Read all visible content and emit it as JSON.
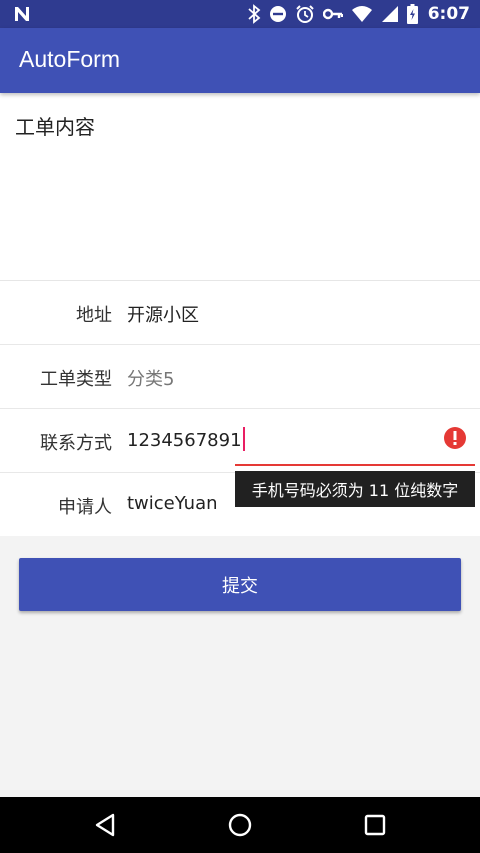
{
  "status_bar": {
    "time": "6:07",
    "icons": [
      "n-notification-icon",
      "bluetooth-icon",
      "do-not-disturb-icon",
      "alarm-icon",
      "key-icon",
      "wifi-icon",
      "signal-icon",
      "battery-icon"
    ]
  },
  "app_bar": {
    "title": "AutoForm"
  },
  "form": {
    "content_label": "工单内容",
    "rows": [
      {
        "label": "地址",
        "value": "开源小区"
      },
      {
        "label": "工单类型",
        "value": "分类5"
      },
      {
        "label": "联系方式",
        "value": "1234567891"
      },
      {
        "label": "申请人",
        "value": "twiceYuan"
      }
    ],
    "error_tooltip": "手机号码必须为 11 位纯数字"
  },
  "submit_button": {
    "label": "提交"
  },
  "colors": {
    "primary": "#3f51b5",
    "primary_dark": "#2f3b90",
    "error": "#e53935",
    "caret": "#e91e63"
  },
  "nav_bar": {
    "icons": [
      "back-icon",
      "home-icon",
      "recents-icon"
    ]
  }
}
